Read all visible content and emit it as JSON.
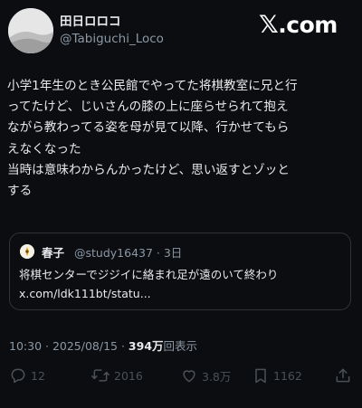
{
  "author": {
    "display_name": "田日ロロコ",
    "handle": "@Tabiguchi_Loco"
  },
  "brand": {
    "x_mark": "𝕏",
    "text": ".com"
  },
  "tweet": {
    "lines": [
      "小学1年生のとき公民館でやってた将棋教室に兄と行",
      "ってたけど、じいさんの膝の上に座らせられて抱え",
      "ながら教わってる姿を母が見て以降、行かせてもら",
      "えなくなった",
      "当時は意味わからんかったけど、思い返すとゾッと",
      "する"
    ]
  },
  "quote": {
    "author_name": "春子",
    "meta": "@study16437 · 3日",
    "lines": [
      "将棋センターでジジイに絡まれ足が遠のいて終わり",
      "x.com/ldk111bt/statu..."
    ]
  },
  "timestamp": {
    "time_date": "10:30 · 2025/08/15 · ",
    "views_count": "394万",
    "views_label": "回表示"
  },
  "actions": {
    "reply_count": "12",
    "repost_count": "2016",
    "like_count": "3.8万",
    "bookmark_count": "1162"
  },
  "icons": {
    "reply": "speech-bubble-icon",
    "repost": "repost-arrows-icon",
    "like": "heart-icon",
    "bookmark": "bookmark-icon",
    "share": "share-upload-icon"
  },
  "colors": {
    "background": "#0b0d10",
    "text_primary": "#e7e9ea",
    "text_secondary": "#8b98a5",
    "border": "#2f3336",
    "action_icons": "#4b5157"
  }
}
